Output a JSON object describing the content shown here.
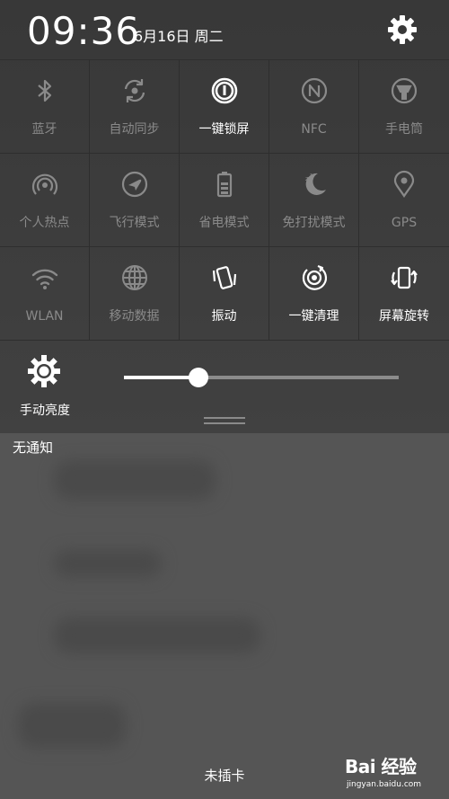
{
  "status": {
    "time": "09:36",
    "date": "6月16日 周二"
  },
  "toggles": [
    {
      "label": "蓝牙",
      "icon": "bluetooth-icon",
      "active": false
    },
    {
      "label": "自动同步",
      "icon": "sync-icon",
      "active": false
    },
    {
      "label": "一键锁屏",
      "icon": "lock-screen-icon",
      "active": true
    },
    {
      "label": "NFC",
      "icon": "nfc-icon",
      "active": false
    },
    {
      "label": "手电筒",
      "icon": "flashlight-icon",
      "active": false
    },
    {
      "label": "个人热点",
      "icon": "hotspot-icon",
      "active": false
    },
    {
      "label": "飞行模式",
      "icon": "airplane-icon",
      "active": false
    },
    {
      "label": "省电模式",
      "icon": "battery-saver-icon",
      "active": false
    },
    {
      "label": "免打扰模式",
      "icon": "do-not-disturb-icon",
      "active": false
    },
    {
      "label": "GPS",
      "icon": "gps-icon",
      "active": false
    },
    {
      "label": "WLAN",
      "icon": "wifi-icon",
      "active": false
    },
    {
      "label": "移动数据",
      "icon": "mobile-data-icon",
      "active": false
    },
    {
      "label": "振动",
      "icon": "vibrate-icon",
      "active": true
    },
    {
      "label": "一键清理",
      "icon": "clean-icon",
      "active": true
    },
    {
      "label": "屏幕旋转",
      "icon": "rotate-icon",
      "active": true
    }
  ],
  "brightness": {
    "label": "手动亮度",
    "level": 0.27
  },
  "notifications": {
    "empty_label": "无通知"
  },
  "footer": {
    "sim_status": "未插卡"
  },
  "watermark": {
    "brand": "Bai 经验",
    "url": "jingyan.baidu.com"
  },
  "colors": {
    "active": "#ffffff",
    "inactive": "#8a8a8a"
  }
}
